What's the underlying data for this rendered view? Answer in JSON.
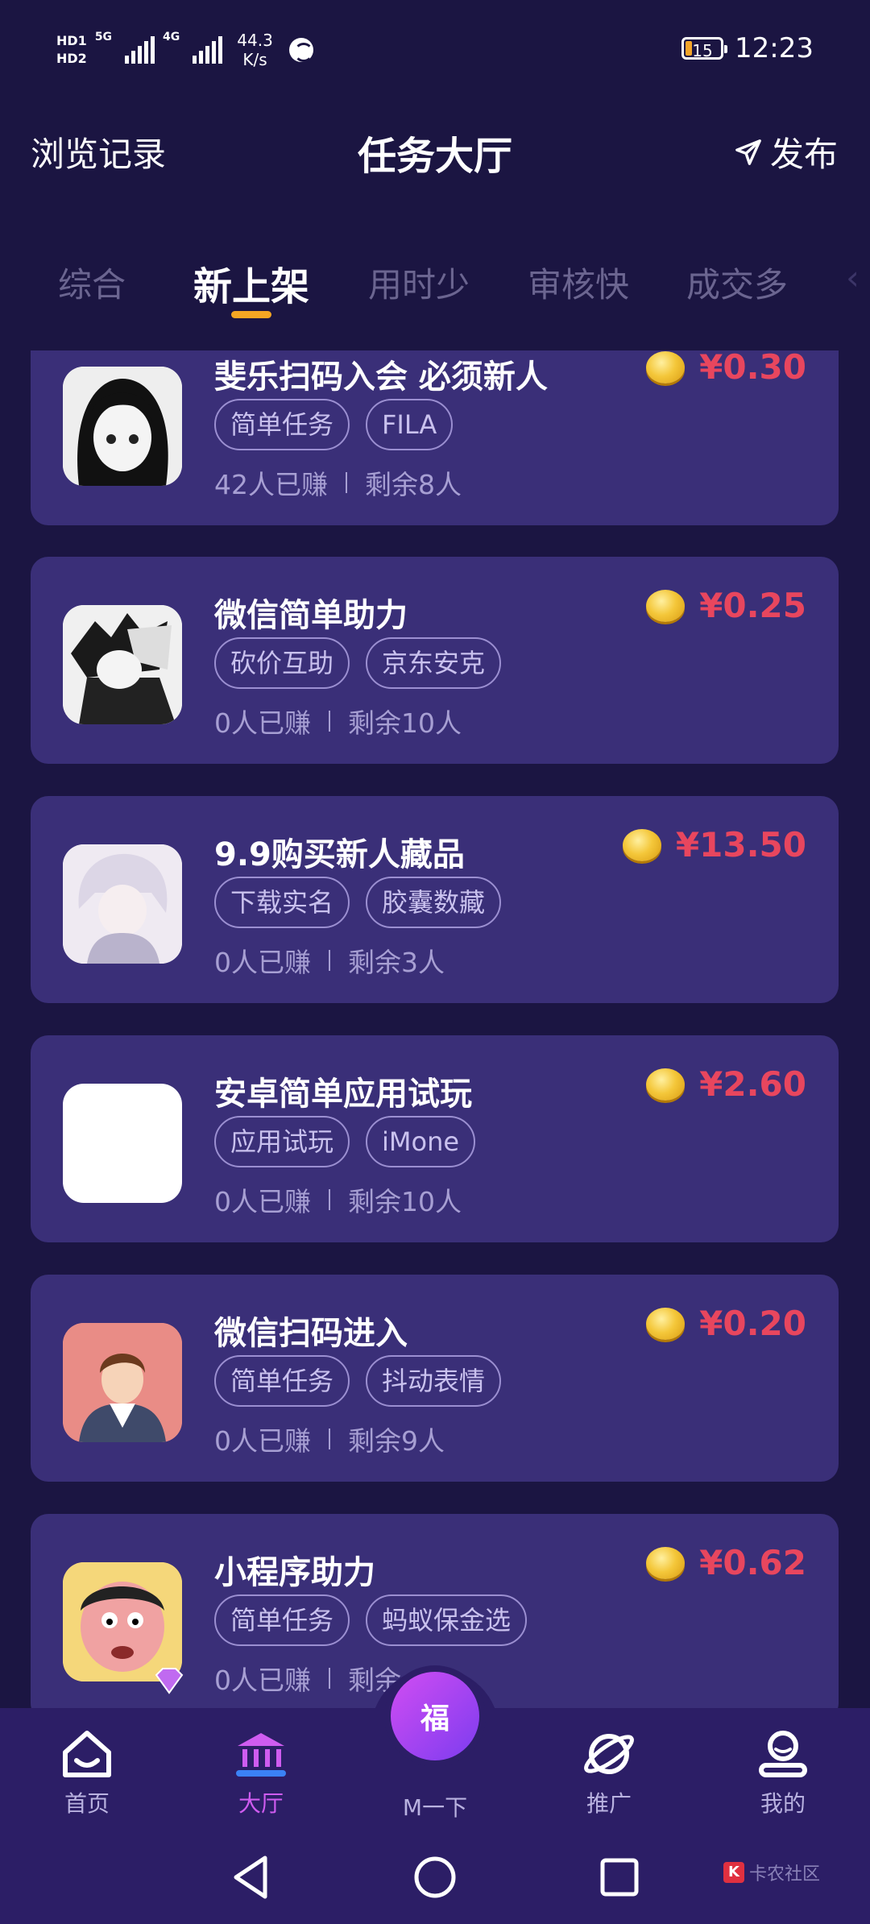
{
  "status_bar": {
    "hd1": "HD1",
    "hd2": "HD2",
    "net1": "5G",
    "net2": "4G",
    "speed_value": "44.3",
    "speed_unit": "K/s",
    "battery": "15",
    "time": "12:23"
  },
  "header": {
    "left_label": "浏览记录",
    "title": "任务大厅",
    "right_label": "发布",
    "right_icon": "send-icon"
  },
  "tabs": [
    {
      "label": "综合",
      "active": false
    },
    {
      "label": "新上架",
      "active": true
    },
    {
      "label": "用时少",
      "active": false
    },
    {
      "label": "审核快",
      "active": false
    },
    {
      "label": "成交多",
      "active": false
    }
  ],
  "tasks": [
    {
      "title": "斐乐扫码入会 必须新人",
      "tags": [
        "简单任务",
        "FILA"
      ],
      "earned": "42人已赚",
      "remaining": "剩余8人",
      "price": "¥0.30",
      "avatar": "dark-hair-girl"
    },
    {
      "title": "微信简单助力",
      "tags": [
        "砍价互助",
        "京东安克"
      ],
      "earned": "0人已赚",
      "remaining": "剩余10人",
      "price": "¥0.25",
      "avatar": "anime-boy"
    },
    {
      "title": "9.9购买新人藏品",
      "tags": [
        "下载实名",
        "胶囊数藏"
      ],
      "earned": "0人已赚",
      "remaining": "剩余3人",
      "price": "¥13.50",
      "avatar": "pastel-boy"
    },
    {
      "title": "安卓简单应用试玩",
      "tags": [
        "应用试玩",
        "iMone"
      ],
      "earned": "0人已赚",
      "remaining": "剩余10人",
      "price": "¥2.60",
      "avatar": "blank"
    },
    {
      "title": "微信扫码进入",
      "tags": [
        "简单任务",
        "抖动表情"
      ],
      "earned": "0人已赚",
      "remaining": "剩余9人",
      "price": "¥0.20",
      "avatar": "cartoon-man"
    },
    {
      "title": "小程序助力",
      "tags": [
        "简单任务",
        "蚂蚁保金选"
      ],
      "earned": "0人已赚",
      "remaining": "剩余",
      "price": "¥0.62",
      "avatar": "cartoon-face"
    }
  ],
  "bottom_nav": {
    "items": [
      {
        "label": "首页",
        "icon": "home-icon",
        "active": false
      },
      {
        "label": "大厅",
        "icon": "hall-icon",
        "active": true
      },
      {
        "label": "推广",
        "icon": "planet-icon",
        "active": false
      },
      {
        "label": "我的",
        "icon": "profile-icon",
        "active": false
      }
    ],
    "center_label": "M一下",
    "center_glyph": "福"
  },
  "watermark": "卡农社区",
  "colors": {
    "background": "#1b1542",
    "card": "#3a2f78",
    "price": "#e8465e",
    "active_tab_underline": "#f5a623",
    "nav_active": "#cf5cf0",
    "nav_bg": "#2c1e66"
  }
}
